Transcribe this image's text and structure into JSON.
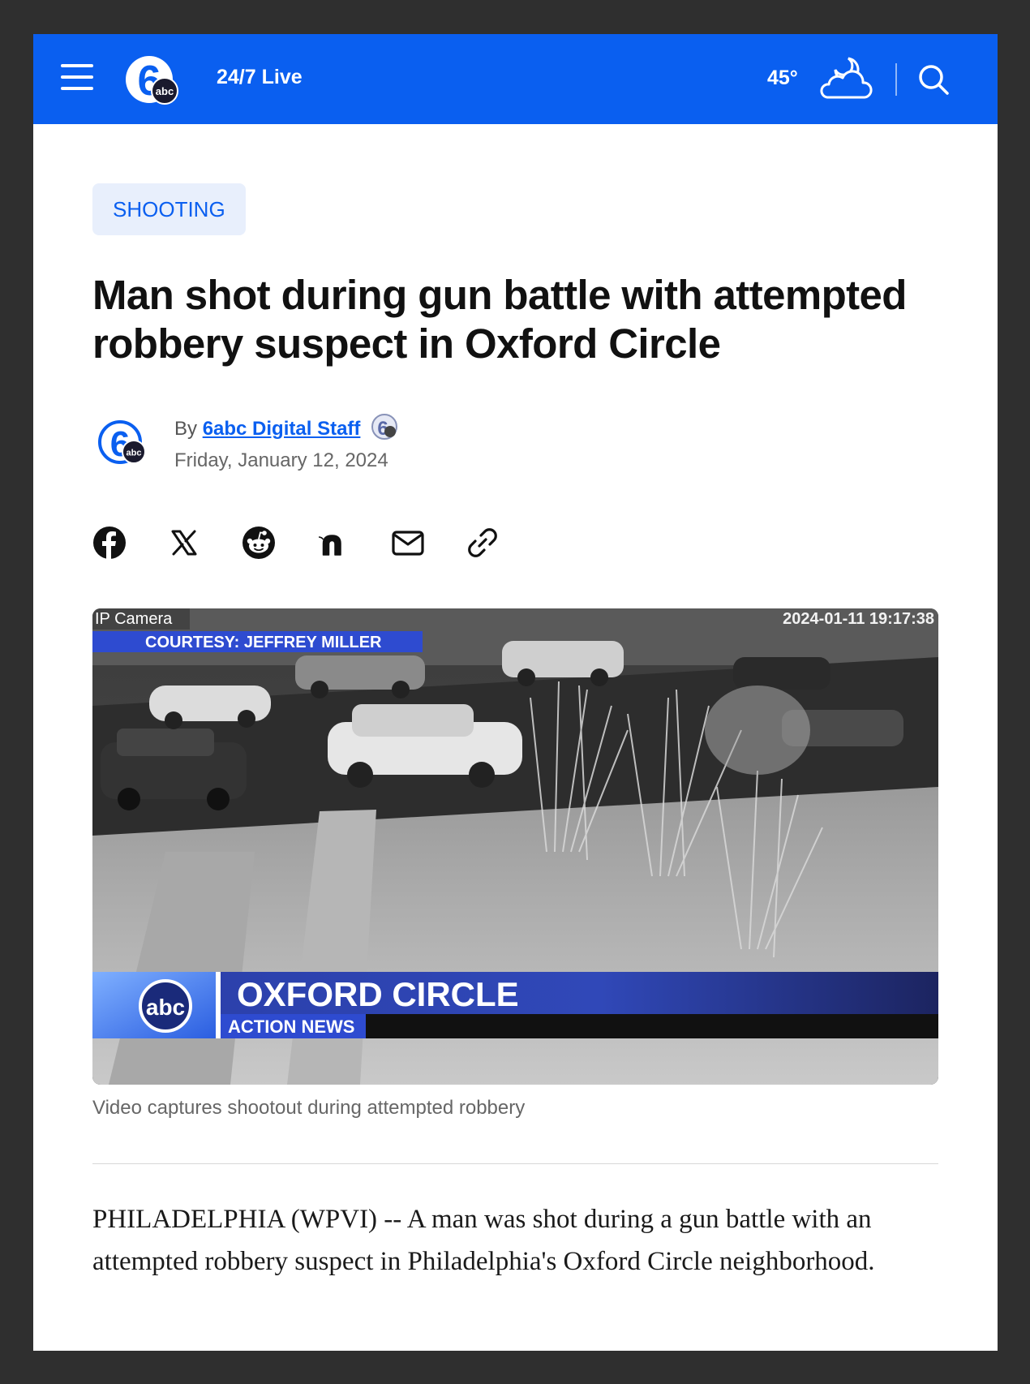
{
  "header": {
    "live_label": "24/7 Live",
    "temperature": "45°",
    "weather_icon": "cloud-moon-icon",
    "logo_text": "6abc",
    "brand_color": "#0a5ff0"
  },
  "article": {
    "category": "SHOOTING",
    "headline": "Man shot during gun battle with attempted robbery suspect in Oxford Circle",
    "byline_prefix": "By",
    "author": "6abc Digital Staff",
    "date": "Friday, January 12, 2024",
    "share_icons": [
      "facebook-icon",
      "x-icon",
      "reddit-icon",
      "nextdoor-icon",
      "email-icon",
      "link-icon"
    ],
    "video": {
      "camera_label": "IP Camera",
      "timestamp": "2024-01-11 19:17:38",
      "courtesy": "COURTESY: JEFFREY MILLER",
      "location_banner": "OXFORD CIRCLE",
      "show_name": "ACTION NEWS",
      "network_logo": "abc"
    },
    "caption": "Video captures shootout during attempted robbery",
    "body": "PHILADELPHIA (WPVI) -- A man was shot during a gun battle with an attempted robbery suspect in Philadelphia's Oxford Circle neighborhood."
  }
}
